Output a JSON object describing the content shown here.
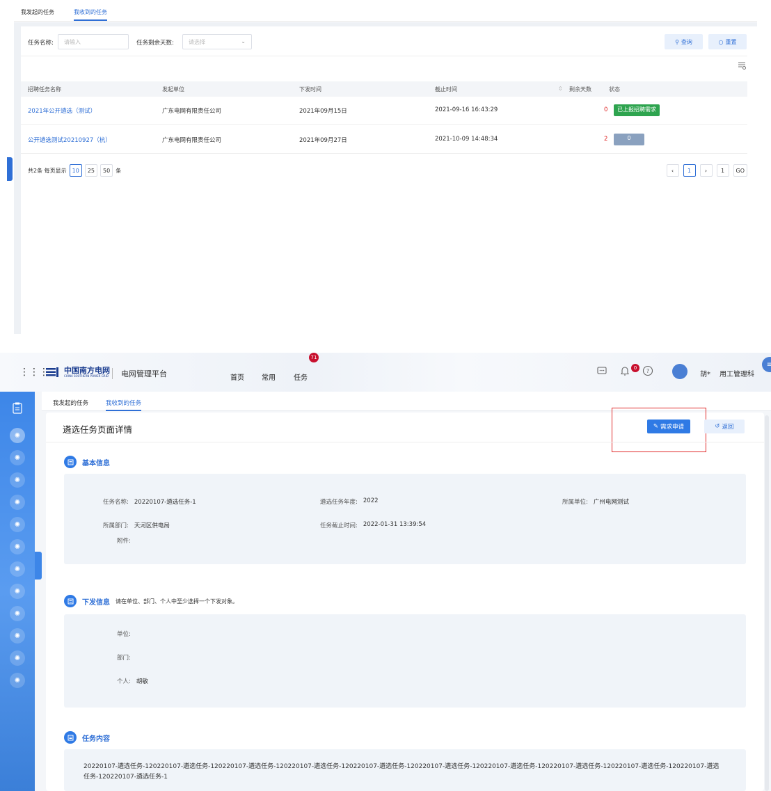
{
  "top": {
    "tabs": [
      {
        "label": "我发起的任务",
        "active": false
      },
      {
        "label": "我收到的任务",
        "active": true
      }
    ],
    "filters": {
      "name_label": "任务名称:",
      "name_placeholder": "请输入",
      "days_label": "任务剩余天数:",
      "days_placeholder": "请选择"
    },
    "buttons": {
      "query": "查询",
      "reset": "重置"
    },
    "table": {
      "headers": [
        "招聘任务名称",
        "发起单位",
        "下发时间",
        "截止时间",
        "剩余天数",
        "状态"
      ],
      "rows": [
        {
          "name": "2021年公开遴选（测试）",
          "unit": "广东电网有限责任公司",
          "issued": "2021年09月15日",
          "deadline": "2021-09-16 16:43:29",
          "days": "0",
          "status": "已上报招聘需求"
        },
        {
          "name": "公开遴选测试20210927（杭）",
          "unit": "广东电网有限责任公司",
          "issued": "2021年09月27日",
          "deadline": "2021-10-09 14:48:34",
          "days": "2",
          "status": "0"
        }
      ]
    },
    "pager": {
      "summary": "共2条 每页显示",
      "sizes": [
        "10",
        "25",
        "50"
      ],
      "unit": "条",
      "prev": "‹",
      "current": "1",
      "next": "›",
      "goto_value": "1",
      "go": "GO"
    }
  },
  "bottom": {
    "header": {
      "logo_text": "中国南方电网",
      "logo_sub": "CHINA SOUTHERN POWER GRID",
      "platform": "电网管理平台",
      "nav": [
        "首页",
        "常用",
        "任务"
      ],
      "task_badge": "71",
      "bell_badge": "0",
      "user_name": "胡*",
      "user_dept": "用工管理科"
    },
    "tabs": [
      {
        "label": "我发起的任务",
        "active": false
      },
      {
        "label": "我收到的任务",
        "active": true
      }
    ],
    "page_title": "遴选任务页面详情",
    "buttons": {
      "apply": "需求申请",
      "back": "返回"
    },
    "basic": {
      "title": "基本信息",
      "task_name_label": "任务名称:",
      "task_name": "20220107-遴选任务-1",
      "year_label": "遴选任务年度:",
      "year": "2022",
      "unit_label": "所属单位:",
      "unit": "广州电网测试",
      "dept_label": "所属部门:",
      "dept": "天河区供电局",
      "deadline_label": "任务截止时间:",
      "deadline": "2022-01-31 13:39:54",
      "attach_label": "附件:"
    },
    "issue": {
      "title": "下发信息",
      "hint": "请在单位、部门、个人中至少选择一个下发对象。",
      "unit_label": "单位:",
      "dept_label": "部门:",
      "person_label": "个人:",
      "person": "胡敏"
    },
    "content": {
      "title": "任务内容",
      "text": "20220107-遴选任务-120220107-遴选任务-120220107-遴选任务-120220107-遴选任务-120220107-遴选任务-120220107-遴选任务-120220107-遴选任务-120220107-遴选任务-120220107-遴选任务-120220107-遴选任务-120220107-遴选任务-1"
    }
  }
}
